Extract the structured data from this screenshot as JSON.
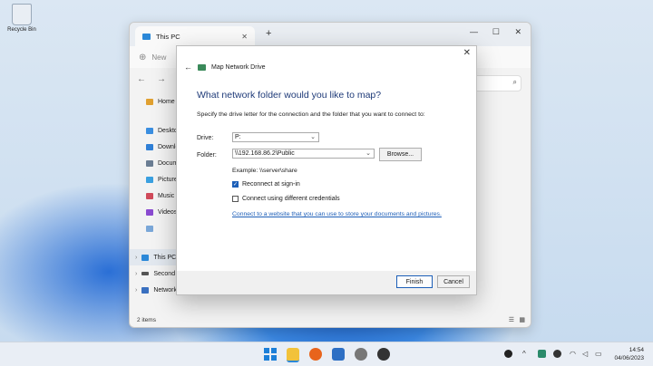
{
  "desktop": {
    "recycle_bin_label": "Recycle Bin"
  },
  "explorer": {
    "tab_title": "This PC",
    "new_label": "New",
    "nav_items": [
      {
        "label": "Home",
        "color": "#e0a030"
      },
      {
        "label": "Desktop",
        "color": "#3a8ee0"
      },
      {
        "label": "Downloads",
        "color": "#2f7fd6"
      },
      {
        "label": "Documents",
        "color": "#6a7d93"
      },
      {
        "label": "Pictures",
        "color": "#3aa0e0"
      },
      {
        "label": "Music",
        "color": "#d04a5a"
      },
      {
        "label": "Videos",
        "color": "#8a4ad0"
      },
      {
        "label": "",
        "color": "#7aa7d8"
      },
      {
        "label": "This PC",
        "color": "#2b88d8"
      },
      {
        "label": "Second",
        "color": "#555555"
      },
      {
        "label": "Network",
        "color": "#3a70c0"
      }
    ],
    "status": "2 items"
  },
  "dialog": {
    "title": "Map Network Drive",
    "heading": "What network folder would you like to map?",
    "description": "Specify the drive letter for the connection and the folder that you want to connect to:",
    "drive_label": "Drive:",
    "drive_value": "P:",
    "folder_label": "Folder:",
    "folder_value": "\\\\192.168.86.2\\Public",
    "browse_label": "Browse...",
    "example": "Example: \\\\server\\share",
    "reconnect_label": "Reconnect at sign-in",
    "reconnect_checked": true,
    "credentials_label": "Connect using different credentials",
    "credentials_checked": false,
    "link": "Connect to a website that you can use to store your documents and pictures.",
    "finish_label": "Finish",
    "cancel_label": "Cancel"
  },
  "taskbar": {
    "time": "14:54",
    "date": "04/06/2023"
  }
}
